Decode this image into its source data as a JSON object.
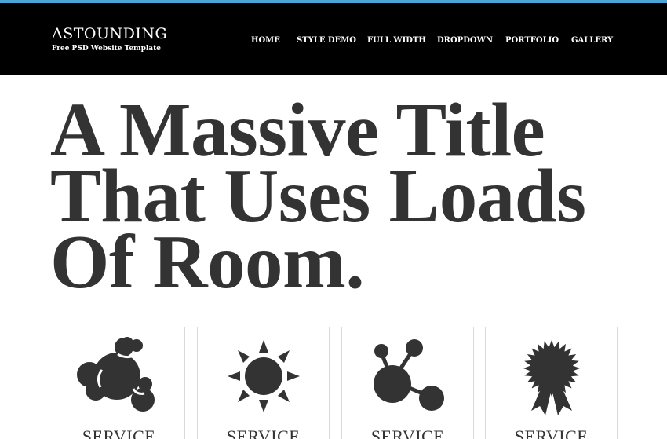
{
  "header": {
    "logo_title": "ASTOUNDING",
    "logo_tagline": "Free PSD Website Template",
    "nav": [
      "HOME",
      "STYLE DEMO",
      "FULL WIDTH",
      "DROPDOWN",
      "PORTFOLIO",
      "GALLERY"
    ]
  },
  "hero": {
    "lines": [
      "A Massive Title",
      "That Uses Loads",
      "Of Room."
    ]
  },
  "services": [
    {
      "icon": "blob-cluster-icon",
      "label": "SERVICE"
    },
    {
      "icon": "sun-icon",
      "label": "SERVICE"
    },
    {
      "icon": "molecule-icon",
      "label": "SERVICE"
    },
    {
      "icon": "award-ribbon-icon",
      "label": "SERVICE"
    }
  ],
  "colors": {
    "accent": "#4ba3d6",
    "header_bg": "#000000",
    "text": "#333333",
    "icon": "#333333"
  }
}
